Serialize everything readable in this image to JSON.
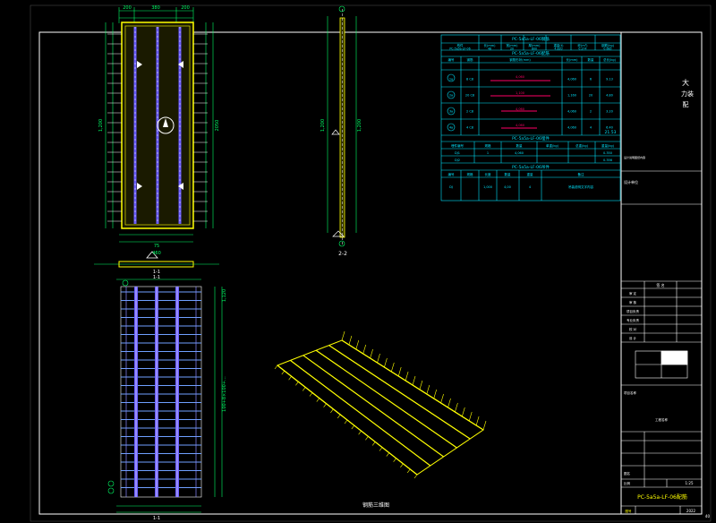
{
  "left_view": {
    "dims_top": [
      "200",
      "380",
      "200"
    ],
    "dim_left": "1,200",
    "dim_right": "2050",
    "dims_bottom": [
      "75",
      "460"
    ],
    "label_bottom": "1-1"
  },
  "section_view": {
    "dim_left": "1,200",
    "dim_right": "1,200",
    "label": "2-2"
  },
  "plan_view": {
    "top_label": "1-1",
    "dim_right_top": "1,120",
    "dim_right_main": "100+8×100+...",
    "bottom_label": "1-1"
  },
  "iso_view": {
    "caption": "钢筋三维图"
  },
  "table": {
    "title1": "PC-5a5a-LF-06钢筋",
    "headers1": [
      "构件",
      "长(mm)",
      "宽(mm)",
      "厚(mm)",
      "重量(t)",
      "砼(m³)",
      "钢筋(kg)"
    ],
    "row1": [
      "PC-5a5a-LF-06",
      "48",
      "20",
      "800",
      "4,820",
      "0.274",
      "0.685"
    ],
    "title2": "PC-5a5a-LF-06配筋",
    "headers2": [
      "编号",
      "钢筋",
      "钢筋形状(mm)",
      "长(mm)",
      "数量",
      "总长(kg)"
    ],
    "rows2": [
      {
        "id": "1a",
        "spec": "8 C8",
        "dim": "4,060",
        "len": "4,060",
        "qty": "6",
        "wt": "9.13"
      },
      {
        "id": "2a",
        "spec": "20 C8",
        "dim": "1,100",
        "len": "1,160",
        "qty": "20",
        "wt": "4.80"
      },
      {
        "id": "3a",
        "spec": "2 C8",
        "dim": "4,060",
        "len": "4,060",
        "qty": "2",
        "wt": "3.20"
      },
      {
        "id": "4a",
        "spec": "4 C8",
        "dim": "4,060",
        "len": "4,060",
        "qty": "4",
        "wt": "6.40"
      }
    ],
    "total_a": "21.53",
    "title3": "PC-5a5a-LF-06埋件",
    "headers3": [
      "埋件编号",
      "规格",
      "数量",
      "单重(kg)",
      "总重(kg)",
      "重量(kg)"
    ],
    "rows3": [
      [
        "DJ1",
        "1",
        "4,060",
        "",
        "",
        "0.350"
      ],
      [
        "DJ2",
        "",
        "",
        "",
        "",
        "0.356"
      ]
    ],
    "title4": "PC-5a5a-LF-06吊件",
    "headers4": [
      "编号",
      "规格",
      "长度",
      "数量",
      "重量",
      "备注"
    ],
    "row4": [
      "DJ",
      "",
      "1,000",
      "4,00",
      "4",
      "吊装说明文字内容"
    ]
  },
  "title_block": {
    "big_text": "大",
    "sub_text_1": "力装",
    "sub_text_2": "配",
    "note": "设计说明图纸内容",
    "design_unit": "设计单位",
    "rows": [
      "审 定",
      "审 核",
      "项目负责",
      "专业负责",
      "校 对",
      "设 计"
    ],
    "row_right": "签 名",
    "project": "项目名称",
    "project_sub": "工程名称",
    "drawing_label": "图名",
    "drawing_title": "PC-5a5a-LF-06配筋",
    "scale_label": "比例",
    "scale": "1:25",
    "date": "2022",
    "sheet": "图号",
    "page": "40"
  },
  "colors": {
    "frame": "#ffffff",
    "table_lines": "#00e5ff",
    "panel_outline": "#ffff00",
    "rebar": "#6a5cff",
    "dim": "#00ff66",
    "rebar_mark": "#ff0066"
  }
}
